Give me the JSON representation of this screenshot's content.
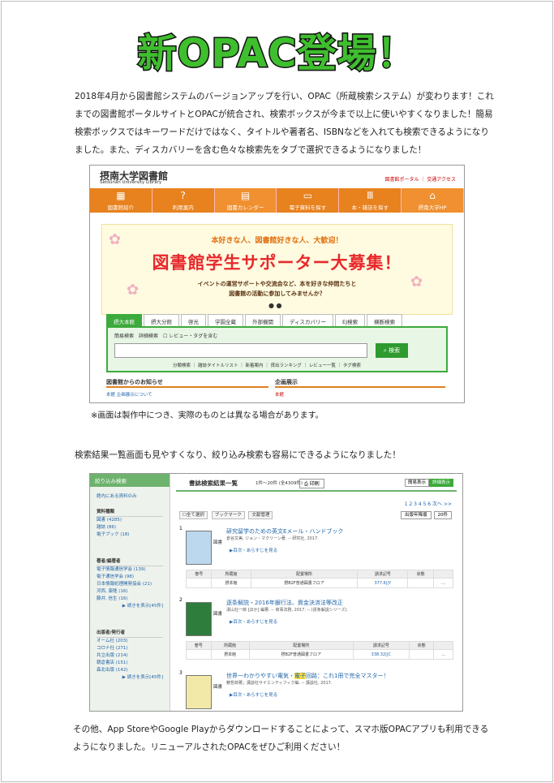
{
  "title": "新OPAC登場！",
  "paragraphs": {
    "p1": "2018年4月から図書館システムのバージョンアップを行い、OPAC（所蔵検索システム）が変わります！これまでの図書館ポータルサイトとOPACが統合され、検索ボックスが今まで以上に使いやすくなりました！簡易検索ボックスではキーワードだけではなく、タイトルや著者名、ISBNなどを入れても検索できるようになりました。また、ディスカバリーを含む色々な検索先をタブで選択できるようになりました！",
    "note": "※画面は製作中につき、実際のものとは異なる場合があります。",
    "p2": "検索結果一覧画面も見やすくなり、絞り込み検索も容易にできるようになりました！",
    "p3": "その他、App StoreやGoogle Playからダウンロードすることによって、スマホ版OPACアプリも利用できるようになりました。リニューアルされたOPACをぜひご利用ください！"
  },
  "shot1": {
    "logo": "摂南大学図書館",
    "logo_sub": "Setsunan University Library",
    "links": "図書館ポータル ｜ 交通アクセス",
    "nav": [
      {
        "icon": "▦",
        "label": "図書館紹介"
      },
      {
        "icon": "?",
        "label": "利用案内"
      },
      {
        "icon": "▤",
        "label": "図書カレンダー"
      },
      {
        "icon": "▭",
        "label": "電子資料を探す"
      },
      {
        "icon": "Ⅲ",
        "label": "本・雑誌を探す"
      },
      {
        "icon": "⌂",
        "label": "摂南大学HP"
      }
    ],
    "banner_line1": "本好きな人、図書館好きな人、大歓迎！",
    "banner_main": "図書館学生サポーター大募集！",
    "banner_line3a": "イベントの運営サポートや交流会など、本を好きな仲間たちと",
    "banner_line3b": "図書館の活動に参加してみませんか？",
    "dots": "● ●",
    "tabs": [
      "摂大本館",
      "摂大分館",
      "啓光",
      "学園全蔵",
      "外部機関",
      "ディスカバリー",
      "EJ検索",
      "横断検索"
    ],
    "search_options": "簡易検索　詳細検索　☐ レビュー・タグを含む",
    "search_button": "検索",
    "search_links": "分類検索 ｜ 雑誌タイトルリスト ｜ 新着案内 ｜ 貸出ランキング ｜ レビュー一覧 ｜ タグ検索",
    "news_heading": "図書館からのお知らせ",
    "event_heading": "企画展示",
    "news_line": "本館  企画展示について",
    "event_line": "本館"
  },
  "shot2": {
    "sidebar_title": "絞り込み検索",
    "sidebar_item": "館内にある資料のみ",
    "groups": [
      {
        "head": "資料種類",
        "items": [
          "図書 (4285)",
          "雑誌 (86)",
          "電子ブック (18)"
        ]
      },
      {
        "head": "著者/編著者",
        "items": [
          "電子情報通信学会 (139)",
          "電子通信学会 (98)",
          "日本情報処理開発協会 (21)",
          "河西, 康隆 (16)",
          "藤井, 信生 (16)"
        ],
        "more": "▶ 続きを表示[45件]"
      },
      {
        "head": "出版者/発行者",
        "items": [
          "オーム社 (203)",
          "コロナ社 (271)",
          "共立出版 (214)",
          "朝倉書店 (151)",
          "森北出版 (142)"
        ],
        "more": "▶ 続きを表示[45件]"
      }
    ],
    "list_title": "書誌検索結果一覧",
    "count": "1件～20件 (全4309件)",
    "print": "印刷",
    "view_simple": "簡易表示",
    "view_detail": "詳細表示",
    "pages": "1  2  3  4  5  6  次へ  >>",
    "tools": [
      "☐全て選択",
      "ブックマーク",
      "文献管理"
    ],
    "sort": "出版年降順",
    "per_page": "20件",
    "columns": [
      "巻号",
      "所蔵館",
      "配置場所",
      "請求記号",
      "状態",
      ""
    ],
    "records": [
      {
        "num": "1",
        "kind": "図書",
        "title_a": "研究留学のための英文Eメール・ハンドブック",
        "title_em": "",
        "title_b": "",
        "by": "倉谷文美, ジョン・マクリーン著. -- 研究社, 2017.",
        "more": "▶目次・あらすじを見る",
        "row": [
          "",
          "摂本館",
          "摂B2F普通図書フロア",
          "377.6||Y",
          "",
          "…"
        ]
      },
      {
        "num": "2",
        "kind": "図書",
        "title_a": "逐条解説・2016年銀行法、資金決済法等改正",
        "title_em": "",
        "title_b": "",
        "by": "湯山壮一郎 [ほか] 編著. -- 商事法務, 2017. -- (逐条解説シリーズ).",
        "more": "▶目次・あらすじを見る",
        "row": [
          "",
          "摂本館",
          "摂B2F普通図書フロア",
          "338.32||C",
          "",
          "…"
        ]
      },
      {
        "num": "3",
        "kind": "図書",
        "title_a": "世界一わかりやすい電気・",
        "title_em": "電子",
        "title_b": "回路：これ1冊で完全マスター！",
        "by": "薮哲郎著；講談社サイエンティフィク編. -- 講談社, 2017.",
        "more": "▶目次・あらすじを見る",
        "row": []
      }
    ]
  }
}
